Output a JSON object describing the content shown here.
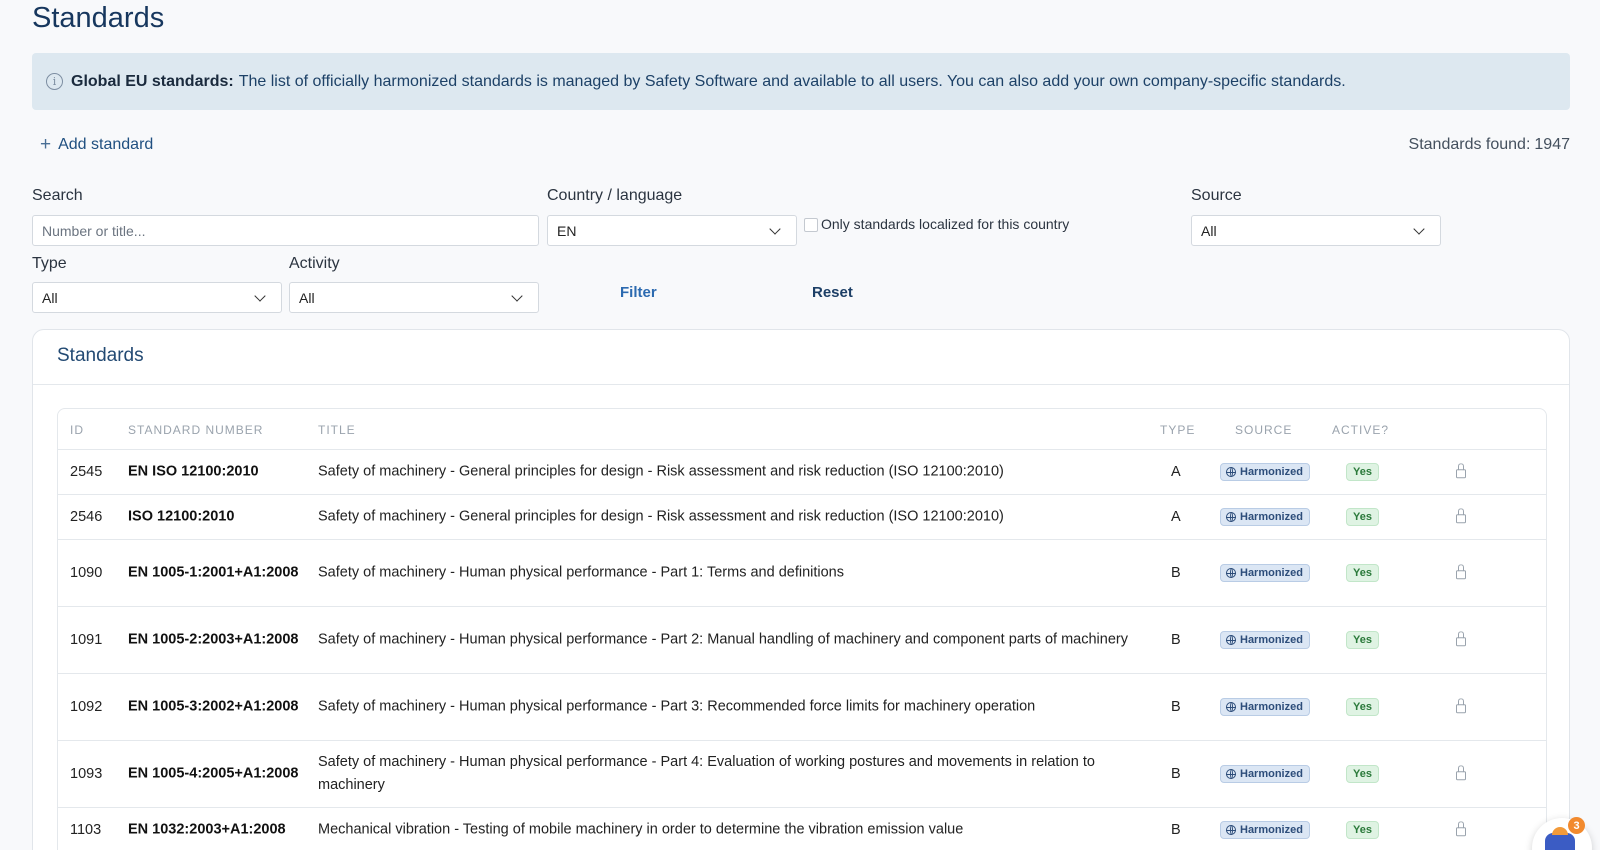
{
  "page_title": "Standards",
  "banner": {
    "icon": "info-icon",
    "bold": "Global EU standards:",
    "text": "The list of officially harmonized standards is managed by Safety Software and available to all users. You can also add your own company-specific standards."
  },
  "toolbar": {
    "add_label": "Add standard",
    "found_label": "Standards found:",
    "found_count": "1947"
  },
  "filters": {
    "search_label": "Search",
    "search_placeholder": "Number or title...",
    "country_label": "Country / language",
    "country_value": "EN",
    "localized_label": "Only standards localized for this country",
    "source_label": "Source",
    "source_value": "All",
    "type_label": "Type",
    "type_value": "All",
    "activity_label": "Activity",
    "activity_value": "All",
    "filter_button": "Filter",
    "reset_button": "Reset"
  },
  "table": {
    "card_title": "Standards",
    "headers": {
      "id": "ID",
      "number": "Standard Number",
      "title": "Title",
      "type": "Type",
      "source": "Source",
      "active": "Active?"
    },
    "rows": [
      {
        "id": "2545",
        "number": "EN ISO 12100:2010",
        "title": "Safety of machinery - General principles for design - Risk assessment and risk reduction (ISO 12100:2010)",
        "type": "A",
        "source": "Harmonized",
        "active": "Yes"
      },
      {
        "id": "2546",
        "number": "ISO 12100:2010",
        "title": "Safety of machinery - General principles for design - Risk assessment and risk reduction (ISO 12100:2010)",
        "type": "A",
        "source": "Harmonized",
        "active": "Yes"
      },
      {
        "id": "1090",
        "number": "EN 1005-1:2001+A1:2008",
        "title": "Safety of machinery - Human physical performance - Part 1: Terms and definitions",
        "type": "B",
        "source": "Harmonized",
        "active": "Yes"
      },
      {
        "id": "1091",
        "number": "EN 1005-2:2003+A1:2008",
        "title": "Safety of machinery - Human physical performance - Part 2: Manual handling of machinery and component parts of machinery",
        "type": "B",
        "source": "Harmonized",
        "active": "Yes"
      },
      {
        "id": "1092",
        "number": "EN 1005-3:2002+A1:2008",
        "title": "Safety of machinery - Human physical performance - Part 3: Recommended force limits for machinery operation",
        "type": "B",
        "source": "Harmonized",
        "active": "Yes"
      },
      {
        "id": "1093",
        "number": "EN 1005-4:2005+A1:2008",
        "title": "Safety of machinery - Human physical performance - Part 4: Evaluation of working postures and movements in relation to machinery",
        "type": "B",
        "source": "Harmonized",
        "active": "Yes"
      },
      {
        "id": "1103",
        "number": "EN 1032:2003+A1:2008",
        "title": "Mechanical vibration - Testing of mobile machinery in order to determine the vibration emission value",
        "type": "B",
        "source": "Harmonized",
        "active": "Yes"
      }
    ]
  },
  "chat_widget": {
    "icon": "chatbot-icon",
    "badge": "3"
  },
  "colors": {
    "title": "#17375e",
    "banner_bg": "#dde8f0",
    "harmonized_badge": "#dbe6f4",
    "yes_badge": "#dff3e3"
  }
}
